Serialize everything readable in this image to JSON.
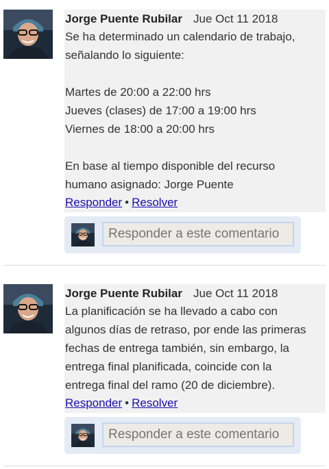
{
  "comments": [
    {
      "author": "Jorge Puente Rubilar",
      "date": "Jue Oct 11 2018",
      "lines": [
        "Se ha determinado un calendario de trabajo,",
        "señalando lo siguiente:",
        "",
        "Martes de 20:00 a 22:00 hrs",
        "Jueves (clases) de 17:00 a 19:00 hrs",
        "Viernes de 18:00 a 20:00 hrs",
        "",
        "En base al tiempo disponible del recurso",
        "humano asignado: Jorge Puente"
      ],
      "reply_label": "Responder",
      "separator": "•",
      "resolve_label": "Resolver",
      "reply_placeholder": "Responder a este comentario"
    },
    {
      "author": "Jorge Puente Rubilar",
      "date": "Jue Oct 11 2018",
      "lines": [
        "La planificación se ha llevado a cabo con",
        "algunos días de retraso, por ende las primeras",
        "fechas de entrega también, sin embargo, la",
        "entrega final planificada, coincide con la",
        "entrega final del ramo (20 de diciembre)."
      ],
      "reply_label": "Responder",
      "separator": "•",
      "resolve_label": "Resolver",
      "reply_placeholder": "Responder a este comentario"
    }
  ],
  "colors": {
    "comment_bg": "#f1f1f1",
    "reply_box_bg": "#e4ebf5",
    "link": "#1a0dab",
    "divider": "#dcdcdc"
  },
  "icons": {
    "avatar": "user-avatar-photo"
  }
}
